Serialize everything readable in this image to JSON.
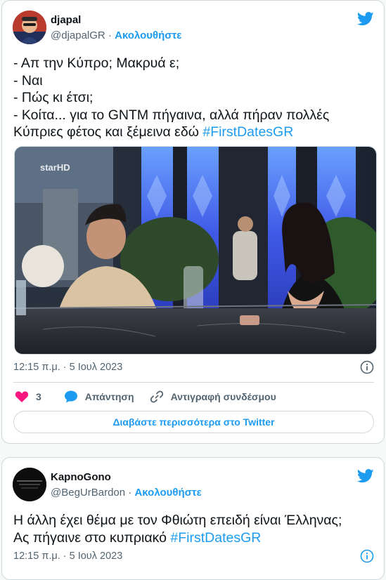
{
  "tweets": [
    {
      "author_name": "djapal",
      "handle": "@djapalGR",
      "separator": "·",
      "follow_label": "Ακολουθήστε",
      "text_plain": "- Απ την Κύπρο; Μακρυά ε;\n- Ναι\n- Πώς κι έτσι;\n- Κοίτα... για το GNTM πήγαινα, αλλά πήραν πολλές Κύπριες φέτος και ξέμεινα εδώ ",
      "hashtag": "#FirstDatesGR",
      "media_logo": "starHD",
      "timestamp": "12:15 π.μ. · 5 Ιουλ 2023",
      "like_count": "3",
      "reply_label": "Απάντηση",
      "copy_link_label": "Αντιγραφή συνδέσμου",
      "read_more_label": "Διαβάστε περισσότερα στο Twitter",
      "icons": [
        "twitter-bird-icon",
        "info-icon",
        "heart-icon",
        "reply-bubble-icon",
        "link-icon"
      ]
    },
    {
      "author_name": "KapnoGono",
      "handle": "@BegUrBardon",
      "separator": "·",
      "follow_label": "Ακολουθήστε",
      "text_plain": "Η άλλη έχει θέμα με τον Φθιώτη επειδή είναι Έλληνας;\nΑς πήγαινε στο κυπριακό ",
      "hashtag": "#FirstDatesGR",
      "timestamp": "12:15 π.μ. · 5 Ιουλ 2023",
      "icons": [
        "twitter-bird-icon",
        "info-icon"
      ]
    }
  ],
  "colors": {
    "accent": "#1d9bf0",
    "like": "#f91880",
    "muted": "#536471",
    "border": "#cfd9de"
  }
}
